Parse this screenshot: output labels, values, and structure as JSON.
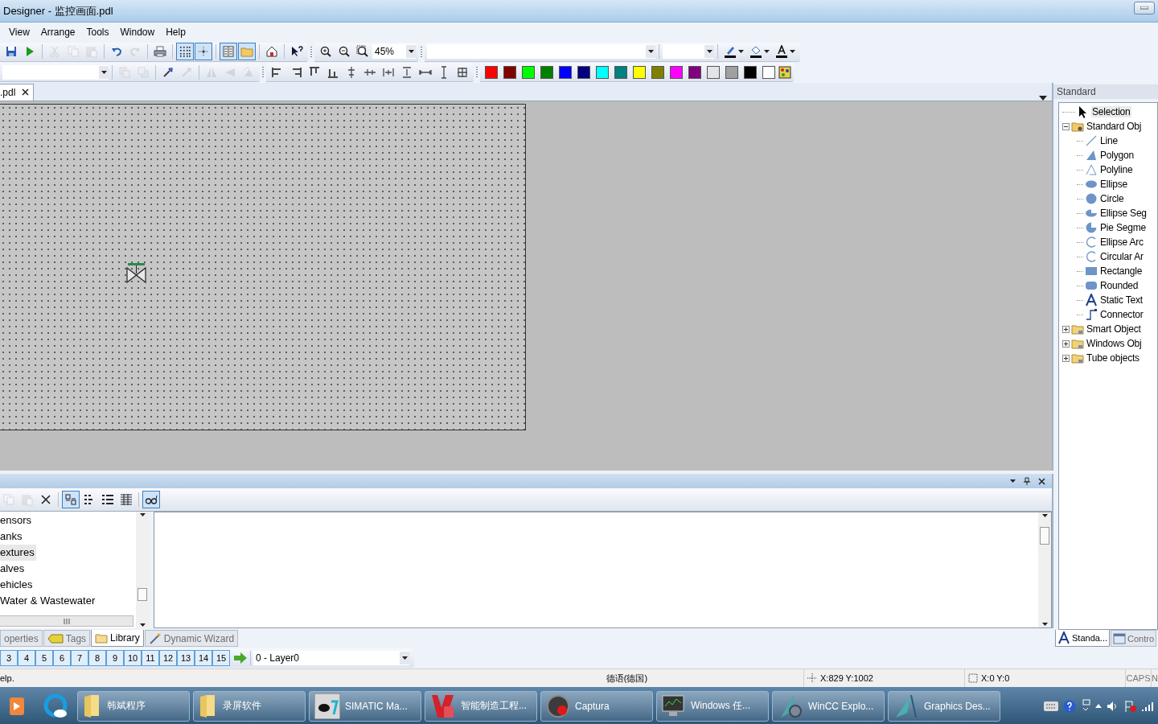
{
  "window": {
    "title": "Designer - 监控画面.pdl"
  },
  "menu": [
    "View",
    "Arrange",
    "Tools",
    "Window",
    "Help"
  ],
  "toolbar_1": {
    "groups": [
      [
        {
          "kind": "save",
          "disabled": false,
          "pressed": false
        },
        {
          "kind": "run",
          "disabled": false,
          "pressed": false
        }
      ],
      [
        {
          "kind": "cut",
          "disabled": true,
          "pressed": false
        },
        {
          "kind": "copy",
          "disabled": true,
          "pressed": false
        },
        {
          "kind": "paste",
          "disabled": true,
          "pressed": false
        }
      ],
      [
        {
          "kind": "undo",
          "disabled": false,
          "pressed": false
        },
        {
          "kind": "redo",
          "disabled": true,
          "pressed": false
        }
      ],
      [
        {
          "kind": "print",
          "disabled": false,
          "pressed": false
        }
      ],
      [
        {
          "kind": "grid",
          "disabled": false,
          "pressed": true
        },
        {
          "kind": "snap",
          "disabled": false,
          "pressed": true
        }
      ],
      [
        {
          "kind": "columns",
          "disabled": false,
          "pressed": true
        },
        {
          "kind": "folder",
          "disabled": false,
          "pressed": true
        }
      ],
      [
        {
          "kind": "house",
          "disabled": false,
          "pressed": false
        }
      ],
      [
        {
          "kind": "helppointer",
          "disabled": false,
          "pressed": false
        }
      ]
    ],
    "zoom_group": [
      {
        "kind": "zoomin",
        "disabled": false,
        "pressed": false
      },
      {
        "kind": "zoomout",
        "disabled": false,
        "pressed": false
      },
      {
        "kind": "zoomarea",
        "disabled": false,
        "pressed": false
      }
    ],
    "zoom": "45%",
    "color_tools": [
      {
        "kind": "pen",
        "disabled": false,
        "pressed": false
      },
      {
        "kind": "bucket",
        "disabled": false,
        "pressed": false
      },
      {
        "kind": "textcolor",
        "disabled": false,
        "pressed": false
      }
    ]
  },
  "toolbar_2": {
    "groups": [
      [
        {
          "kind": "front",
          "disabled": true,
          "pressed": false
        },
        {
          "kind": "back",
          "disabled": true,
          "pressed": false
        }
      ],
      [
        {
          "kind": "dropper",
          "disabled": false,
          "pressed": false
        },
        {
          "kind": "dropper",
          "disabled": true,
          "pressed": false
        }
      ],
      [
        {
          "kind": "fliph",
          "disabled": true,
          "pressed": false
        },
        {
          "kind": "flipv",
          "disabled": true,
          "pressed": false
        },
        {
          "kind": "rotate",
          "disabled": true,
          "pressed": false
        }
      ]
    ],
    "align_group": [
      {
        "kind": "alignleft",
        "disabled": false,
        "pressed": false
      },
      {
        "kind": "alignright",
        "disabled": false,
        "pressed": false
      },
      {
        "kind": "aligntop",
        "disabled": false,
        "pressed": false
      },
      {
        "kind": "alignbottom",
        "disabled": false,
        "pressed": false
      },
      {
        "kind": "centerh",
        "disabled": false,
        "pressed": false
      },
      {
        "kind": "centerv",
        "disabled": false,
        "pressed": false
      },
      {
        "kind": "spaceh",
        "disabled": false,
        "pressed": false
      },
      {
        "kind": "spacev",
        "disabled": false,
        "pressed": false
      },
      {
        "kind": "samew",
        "disabled": false,
        "pressed": false
      },
      {
        "kind": "sameh",
        "disabled": false,
        "pressed": false
      },
      {
        "kind": "samesize",
        "disabled": false,
        "pressed": false
      }
    ],
    "palette": [
      {
        "color": "#ff0000"
      },
      {
        "color": "#800000"
      },
      {
        "color": "#00ff00"
      },
      {
        "color": "#008000"
      },
      {
        "color": "#0000ff"
      },
      {
        "color": "#000080"
      },
      {
        "color": "#00ffff"
      },
      {
        "color": "#008080"
      },
      {
        "color": "#ffff00"
      },
      {
        "color": "#808000"
      },
      {
        "color": "#ff00ff"
      },
      {
        "color": "#800080"
      },
      {
        "color": "#e4e4e8"
      },
      {
        "color": "#a0a0a0"
      },
      {
        "color": "#000000"
      },
      {
        "color": "#ffffff"
      }
    ]
  },
  "document_tab": {
    "label": ".pdl",
    "selected": true
  },
  "object_palette": {
    "title": "Standard",
    "tree": [
      {
        "label": "Selection",
        "kind": "pointer",
        "selected": true
      },
      {
        "label": "Standard Obj",
        "kind": "objfolder",
        "selected": false,
        "expanded": true,
        "children": [
          {
            "label": "Line",
            "kind": "line",
            "selected": false
          },
          {
            "label": "Polygon",
            "kind": "polygon",
            "selected": false
          },
          {
            "label": "Polyline",
            "kind": "polyline",
            "selected": false
          },
          {
            "label": "Ellipse",
            "kind": "ellipse",
            "selected": false
          },
          {
            "label": "Circle",
            "kind": "circle",
            "selected": false
          },
          {
            "label": "Ellipse Seg",
            "kind": "ellipseseg",
            "selected": false
          },
          {
            "label": "Pie Segme",
            "kind": "pie",
            "selected": false
          },
          {
            "label": "Ellipse Arc",
            "kind": "arc",
            "selected": false
          },
          {
            "label": "Circular Ar",
            "kind": "arc",
            "selected": false
          },
          {
            "label": "Rectangle",
            "kind": "rect",
            "selected": false
          },
          {
            "label": "Rounded",
            "kind": "rounded",
            "selected": false
          },
          {
            "label": "Static Text",
            "kind": "text",
            "selected": false
          },
          {
            "label": "Connector",
            "kind": "connector",
            "selected": false
          }
        ]
      },
      {
        "label": "Smart Object",
        "kind": "folder",
        "selected": false,
        "expanded": false
      },
      {
        "label": "Windows Obj",
        "kind": "folder",
        "selected": false,
        "expanded": false
      },
      {
        "label": "Tube objects",
        "kind": "folder",
        "selected": false,
        "expanded": false
      }
    ],
    "tabs": [
      {
        "label": "Standa...",
        "kind": "standard",
        "selected": true
      },
      {
        "label": "Contro",
        "kind": "controls",
        "selected": false
      }
    ]
  },
  "library": {
    "toolbar": {
      "groups": [
        [
          {
            "kind": "copy",
            "disabled": true,
            "pressed": false
          },
          {
            "kind": "paste",
            "disabled": true,
            "pressed": false
          },
          {
            "kind": "delete",
            "disabled": false,
            "pressed": false
          }
        ],
        [
          {
            "kind": "viewlarge",
            "disabled": false,
            "pressed": true
          },
          {
            "kind": "viewsmall",
            "disabled": false,
            "pressed": false
          },
          {
            "kind": "viewlist",
            "disabled": false,
            "pressed": false
          },
          {
            "kind": "viewdetails",
            "disabled": false,
            "pressed": false
          }
        ],
        [
          {
            "kind": "preview",
            "disabled": false,
            "pressed": true
          }
        ]
      ]
    },
    "folders": [
      {
        "label": "ensors",
        "selected": false
      },
      {
        "label": "anks",
        "selected": false
      },
      {
        "label": "extures",
        "selected": true
      },
      {
        "label": "alves",
        "selected": false
      },
      {
        "label": "ehicles",
        "selected": false
      },
      {
        "label": "Water & Wastewater",
        "selected": false
      }
    ]
  },
  "panel_tabs": [
    {
      "label": "operties",
      "kind": "properties",
      "selected": false
    },
    {
      "label": "Tags",
      "kind": "tags",
      "selected": false
    },
    {
      "label": "Library",
      "kind": "library",
      "selected": true
    },
    {
      "label": "Dynamic Wizard",
      "kind": "wizard",
      "selected": false
    }
  ],
  "layers": {
    "buttons": [
      {
        "label": "3",
        "on": true
      },
      {
        "label": "4",
        "on": true
      },
      {
        "label": "5",
        "on": true
      },
      {
        "label": "6",
        "on": true
      },
      {
        "label": "7",
        "on": true
      },
      {
        "label": "8",
        "on": true
      },
      {
        "label": "9",
        "on": true
      },
      {
        "label": "10",
        "on": true
      },
      {
        "label": "11",
        "on": true
      },
      {
        "label": "12",
        "on": true
      },
      {
        "label": "13",
        "on": true
      },
      {
        "label": "14",
        "on": true
      },
      {
        "label": "15",
        "on": true
      }
    ],
    "active_layer": "0 - Layer0"
  },
  "status_bar": {
    "help": "elp.",
    "language": "德语(德国)",
    "position": "X:829 Y:1002",
    "size": "X:0 Y:0",
    "caps": "CAPS",
    "num": "N"
  },
  "taskbar": [
    {
      "kind": "media"
    },
    {
      "kind": "browser"
    },
    {
      "kind": "folder",
      "label": "韩斌程序"
    },
    {
      "kind": "folder",
      "label": "录屏软件"
    },
    {
      "kind": "simatic",
      "label": "SIMATIC Ma..."
    },
    {
      "kind": "wps",
      "label": "智能制造工程..."
    },
    {
      "kind": "record",
      "label": "Captura"
    },
    {
      "kind": "monitor",
      "label": "Windows 任..."
    },
    {
      "kind": "wincc",
      "label": "WinCC Explo..."
    },
    {
      "kind": "graphics",
      "label": "Graphics Des..."
    }
  ]
}
